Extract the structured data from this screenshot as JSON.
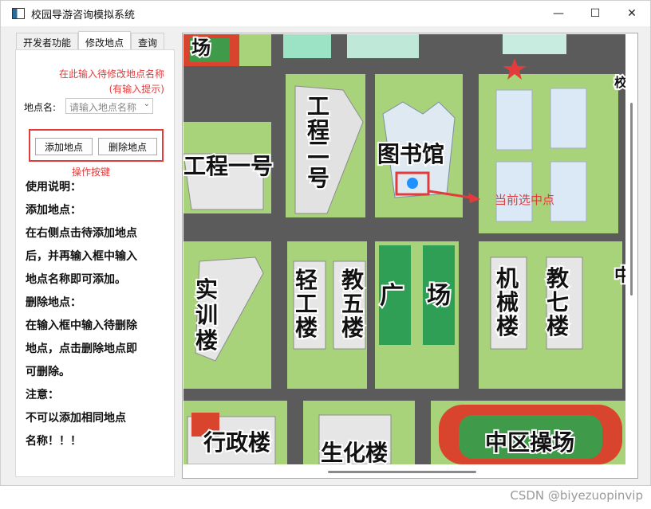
{
  "window": {
    "title": "校园导游咨询模拟系统",
    "minimize": "—",
    "maximize": "☐",
    "close": "✕"
  },
  "tabs": [
    {
      "label": "开发者功能"
    },
    {
      "label": "修改地点"
    },
    {
      "label": "查询"
    }
  ],
  "panel": {
    "note_input": "在此输入待修改地点名称\n(有输入提示)",
    "place_label": "地点名:",
    "place_placeholder": "请输入地点名称",
    "add_button": "添加地点",
    "delete_button": "删除地点",
    "note_buttons": "操作按键",
    "help": [
      "使用说明：",
      "添加地点：",
      "在右侧点击待添加地点",
      "后，并再输入框中输入",
      "地点名称即可添加。",
      "删除地点：",
      "在输入框中输入待删除",
      "地点，点击删除地点即",
      "可删除。",
      "注意：",
      "不可以添加相同地点",
      "名称！！！"
    ]
  },
  "map": {
    "labels": {
      "field_top": "场",
      "engineering1": "工程一号",
      "engineering2_a": "工",
      "engineering2_b": "程",
      "engineering2_c": "二",
      "engineering2_d": "号",
      "library": "图书馆",
      "training_a": "实",
      "training_b": "训",
      "training_c": "楼",
      "light_a": "轻",
      "light_b": "工",
      "light_c": "楼",
      "teach5_a": "教",
      "teach5_b": "五",
      "teach5_c": "楼",
      "square_a": "广",
      "square_b": "场",
      "mech_a": "机",
      "mech_b": "械",
      "mech_c": "楼",
      "teach7_a": "教",
      "teach7_b": "七",
      "teach7_c": "楼",
      "admin": "行政楼",
      "biochem": "生化楼",
      "mid_field": "中区操场",
      "edge_right": "校",
      "edge_right2": "中"
    },
    "selected_annotation": "当前选中点",
    "colors": {
      "accent": "#e23b3b",
      "marker": "#1e90ff",
      "grass": "#a8d37a",
      "road": "#5b5b5b"
    }
  },
  "watermark": "CSDN @biyezuopinvip"
}
